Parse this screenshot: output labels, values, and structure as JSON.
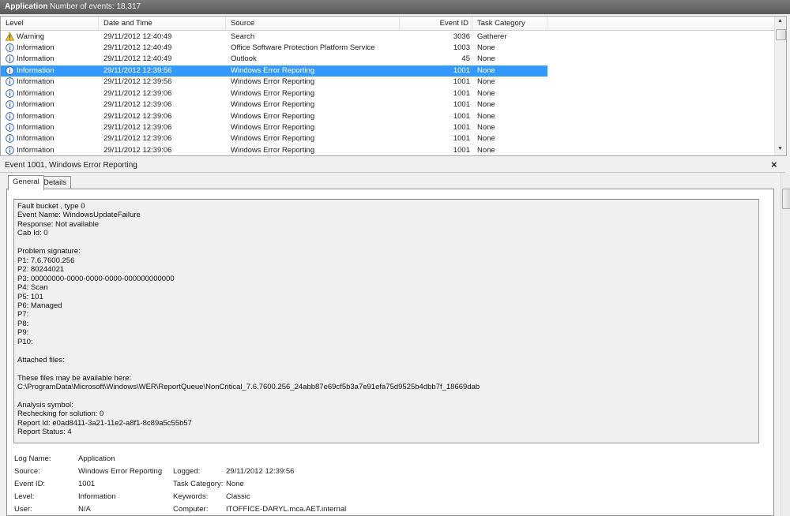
{
  "titlebar": {
    "title": "Application",
    "event_count": "Number of events: 18,317"
  },
  "columns": [
    "Level",
    "Date and Time",
    "Source",
    "Event ID",
    "Task Category"
  ],
  "events": [
    {
      "level": "Warning",
      "icon": "warning-icon",
      "date": "29/11/2012 12:40:49",
      "source": "Search",
      "event_id": "3036",
      "category": "Gatherer",
      "selected": false
    },
    {
      "level": "Information",
      "icon": "info-icon",
      "date": "29/11/2012 12:40:49",
      "source": "Office Software Protection Platform Service",
      "event_id": "1003",
      "category": "None",
      "selected": false
    },
    {
      "level": "Information",
      "icon": "info-icon",
      "date": "29/11/2012 12:40:49",
      "source": "Outlook",
      "event_id": "45",
      "category": "None",
      "selected": false
    },
    {
      "level": "Information",
      "icon": "info-icon",
      "date": "29/11/2012 12:39:56",
      "source": "Windows Error Reporting",
      "event_id": "1001",
      "category": "None",
      "selected": true
    },
    {
      "level": "Information",
      "icon": "info-icon",
      "date": "29/11/2012 12:39:56",
      "source": "Windows Error Reporting",
      "event_id": "1001",
      "category": "None",
      "selected": false
    },
    {
      "level": "Information",
      "icon": "info-icon",
      "date": "29/11/2012 12:39:06",
      "source": "Windows Error Reporting",
      "event_id": "1001",
      "category": "None",
      "selected": false
    },
    {
      "level": "Information",
      "icon": "info-icon",
      "date": "29/11/2012 12:39:06",
      "source": "Windows Error Reporting",
      "event_id": "1001",
      "category": "None",
      "selected": false
    },
    {
      "level": "Information",
      "icon": "info-icon",
      "date": "29/11/2012 12:39:06",
      "source": "Windows Error Reporting",
      "event_id": "1001",
      "category": "None",
      "selected": false
    },
    {
      "level": "Information",
      "icon": "info-icon",
      "date": "29/11/2012 12:39:06",
      "source": "Windows Error Reporting",
      "event_id": "1001",
      "category": "None",
      "selected": false
    },
    {
      "level": "Information",
      "icon": "info-icon",
      "date": "29/11/2012 12:39:06",
      "source": "Windows Error Reporting",
      "event_id": "1001",
      "category": "None",
      "selected": false
    },
    {
      "level": "Information",
      "icon": "info-icon",
      "date": "29/11/2012 12:39:06",
      "source": "Windows Error Reporting",
      "event_id": "1001",
      "category": "None",
      "selected": false
    }
  ],
  "detail": {
    "title": "Event 1001, Windows Error Reporting",
    "close_symbol": "×",
    "tabs": [
      "General",
      "Details"
    ],
    "description": "Fault bucket , type 0\nEvent Name: WindowsUpdateFailure\nResponse: Not available\nCab Id: 0\n\nProblem signature:\nP1: 7.6.7600.256\nP2: 80244021\nP3: 00000000-0000-0000-0000-000000000000\nP4: Scan\nP5: 101\nP6: Managed\nP7:\nP8:\nP9:\nP10:\n\nAttached files:\n\nThese files may be available here:\nC:\\ProgramData\\Microsoft\\Windows\\WER\\ReportQueue\\NonCritical_7.6.7600.256_24abb87e69cf5b3a7e91efa75d9525b4dbb7f_18669dab\n\nAnalysis symbol:\nRechecking for solution: 0\nReport Id: e0ad8411-3a21-11e2-a8f1-8c89a5c55b57\nReport Status: 4",
    "props": {
      "log_name_label": "Log Name:",
      "log_name": "Application",
      "source_label": "Source:",
      "source": "Windows Error Reporting",
      "logged_label": "Logged:",
      "logged": "29/11/2012 12:39:56",
      "event_id_label": "Event ID:",
      "event_id": "1001",
      "task_category_label": "Task Category:",
      "task_category": "None",
      "level_label": "Level:",
      "level": "Information",
      "keywords_label": "Keywords:",
      "keywords": "Classic",
      "user_label": "User:",
      "user": "N/A",
      "computer_label": "Computer:",
      "computer": "ITOFFICE-DARYL.mca.AET.internal"
    }
  },
  "colors": {
    "selection": "#3399ff",
    "titlebar": "#666666",
    "warning": "#f0c419",
    "info": "#2c5fb8"
  }
}
